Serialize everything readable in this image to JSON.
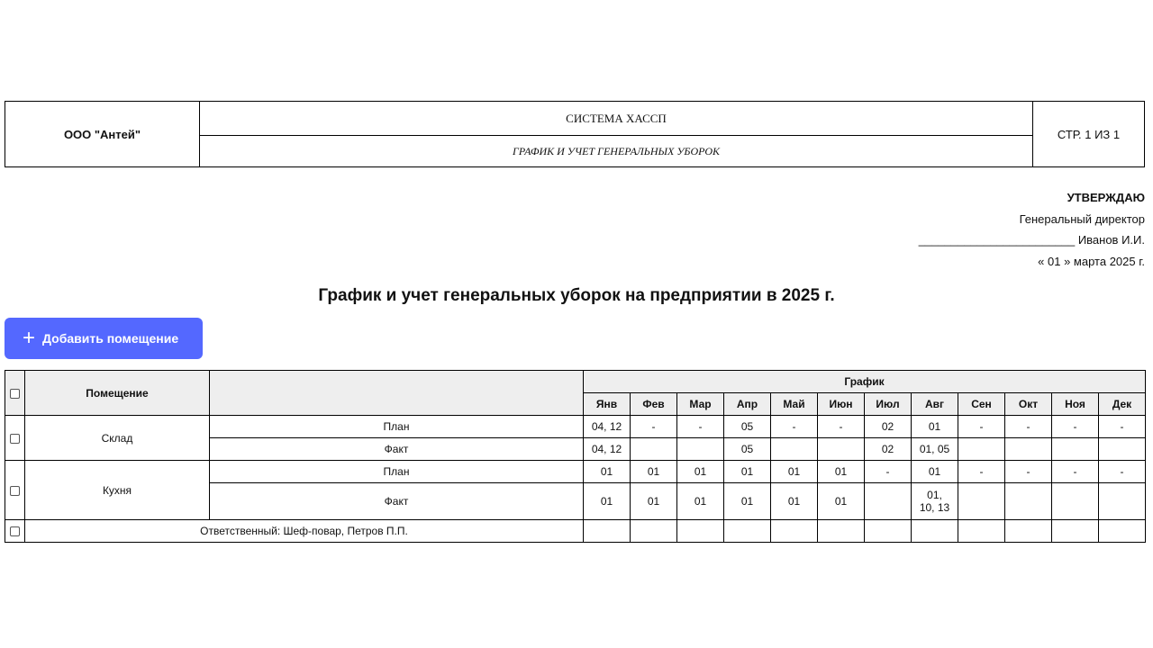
{
  "header": {
    "company": "ООО \"Антей\"",
    "system": "СИСТЕМА ХАССП",
    "doc_name": "ГРАФИК И УЧЕТ ГЕНЕРАЛЬНЫХ УБОРОК",
    "page": "СТР. 1 ИЗ 1"
  },
  "approval": {
    "title": "УТВЕРЖДАЮ",
    "position": "Генеральный директор",
    "signature": "________________________ Иванов И.И.",
    "date": "« 01 » марта 2025 г."
  },
  "title": "График и учет генеральных уборок на предприятии в 2025 г.",
  "add_button": {
    "icon": "plus-icon",
    "label": "Добавить помещение"
  },
  "table": {
    "col_room": "Помещение",
    "col_schedule": "График",
    "months": [
      "Янв",
      "Фев",
      "Мар",
      "Апр",
      "Май",
      "Июн",
      "Июл",
      "Авг",
      "Сен",
      "Окт",
      "Ноя",
      "Дек"
    ],
    "rooms": [
      {
        "name": "Склад",
        "plan_label": "План",
        "fact_label": "Факт",
        "plan": [
          "04, 12",
          "-",
          "-",
          "05",
          "-",
          "-",
          "02",
          "01",
          "-",
          "-",
          "-",
          "-"
        ],
        "fact": [
          "04, 12",
          "",
          "",
          "05",
          "",
          "",
          "02",
          "01, 05",
          "",
          "",
          "",
          ""
        ]
      },
      {
        "name": "Кухня",
        "plan_label": "План",
        "fact_label": "Факт",
        "plan": [
          "01",
          "01",
          "01",
          "01",
          "01",
          "01",
          "-",
          "01",
          "-",
          "-",
          "-",
          "-"
        ],
        "fact": [
          "01",
          "01",
          "01",
          "01",
          "01",
          "01",
          "",
          "01, 10, 13",
          "",
          "",
          "",
          ""
        ]
      }
    ],
    "responsible": "Ответственный: Шеф-повар, Петров П.П."
  }
}
